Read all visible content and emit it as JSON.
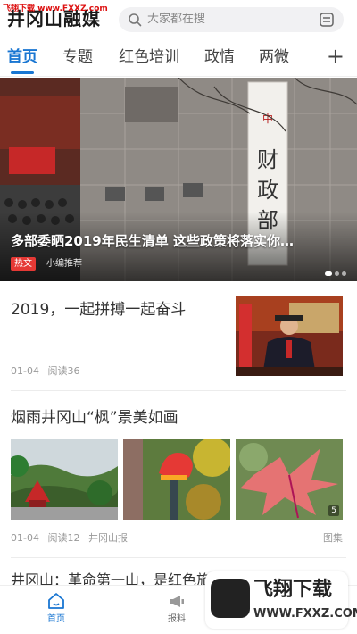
{
  "watermark": "飞翔下载 www.FXXZ.com",
  "header": {
    "logo": "井冈山融媒",
    "search_placeholder": "大家都在搜"
  },
  "tabs": [
    {
      "label": "首页",
      "active": true
    },
    {
      "label": "专题"
    },
    {
      "label": "红色培训"
    },
    {
      "label": "政情"
    },
    {
      "label": "两微"
    }
  ],
  "tabs_more": "+",
  "banner": {
    "title": "多部委晒2019年民生清单 这些政策将落实你…",
    "tag": "热文",
    "source": "小编推荐",
    "sign_text": "中华人民共和国财政部"
  },
  "feed": {
    "item1": {
      "title": "2019，一起拼搏一起奋斗",
      "date": "01-04",
      "reads": "阅读36"
    },
    "item2": {
      "title": "烟雨井冈山“枫”景美如画",
      "date": "01-04",
      "reads": "阅读12",
      "source": "井冈山报",
      "type": "图集",
      "image_count": "5"
    },
    "item3": {
      "title": "井冈山：革命第一山，是红色旅游必选之地！"
    }
  },
  "bottom_nav": [
    {
      "label": "首页",
      "icon": "home-icon",
      "active": true
    },
    {
      "label": "报料",
      "icon": "megaphone-icon"
    }
  ],
  "ad": {
    "name": "飞翔下载",
    "url": "WWW.FXXZ.COM"
  },
  "colors": {
    "accent": "#1976d2",
    "tag_red": "#e53935"
  }
}
